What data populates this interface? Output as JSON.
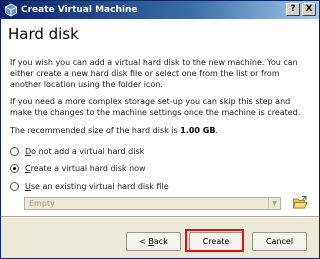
{
  "window": {
    "title": "Create Virtual Machine",
    "help_label": "?",
    "close_label": "X"
  },
  "page": {
    "heading": "Hard disk",
    "intro": "If you wish you can add a virtual hard disk to the new machine. You can either create a new hard disk file or select one from the list or from another location using the folder icon.",
    "advanced": "If you need a more complex storage set-up you can skip this step and make the changes to the machine settings once the machine is created.",
    "recommended_prefix": "The recommended size of the hard disk is ",
    "recommended_size": "1.00 GB",
    "recommended_suffix": "."
  },
  "options": {
    "selected": "create",
    "no_disk": {
      "accel": "D",
      "rest": "o not add a virtual hard disk"
    },
    "create": {
      "accel": "C",
      "rest": "reate a virtual hard disk now"
    },
    "existing": {
      "accel": "U",
      "rest": "se an existing virtual hard disk file"
    }
  },
  "existing_disk_combo": {
    "value": "Empty",
    "enabled": false
  },
  "icons": {
    "app": "virtualbox-icon",
    "folder": "folder-open-icon",
    "combo_arrow": "chevron-down-icon"
  },
  "buttons": {
    "back_prefix": "< ",
    "back_accel": "B",
    "back_rest": "ack",
    "create": "Create",
    "cancel": "Cancel"
  },
  "colors": {
    "title_bar": "#0a246a",
    "dialog_bg": "#ece9d8",
    "highlight": "#e01010"
  }
}
